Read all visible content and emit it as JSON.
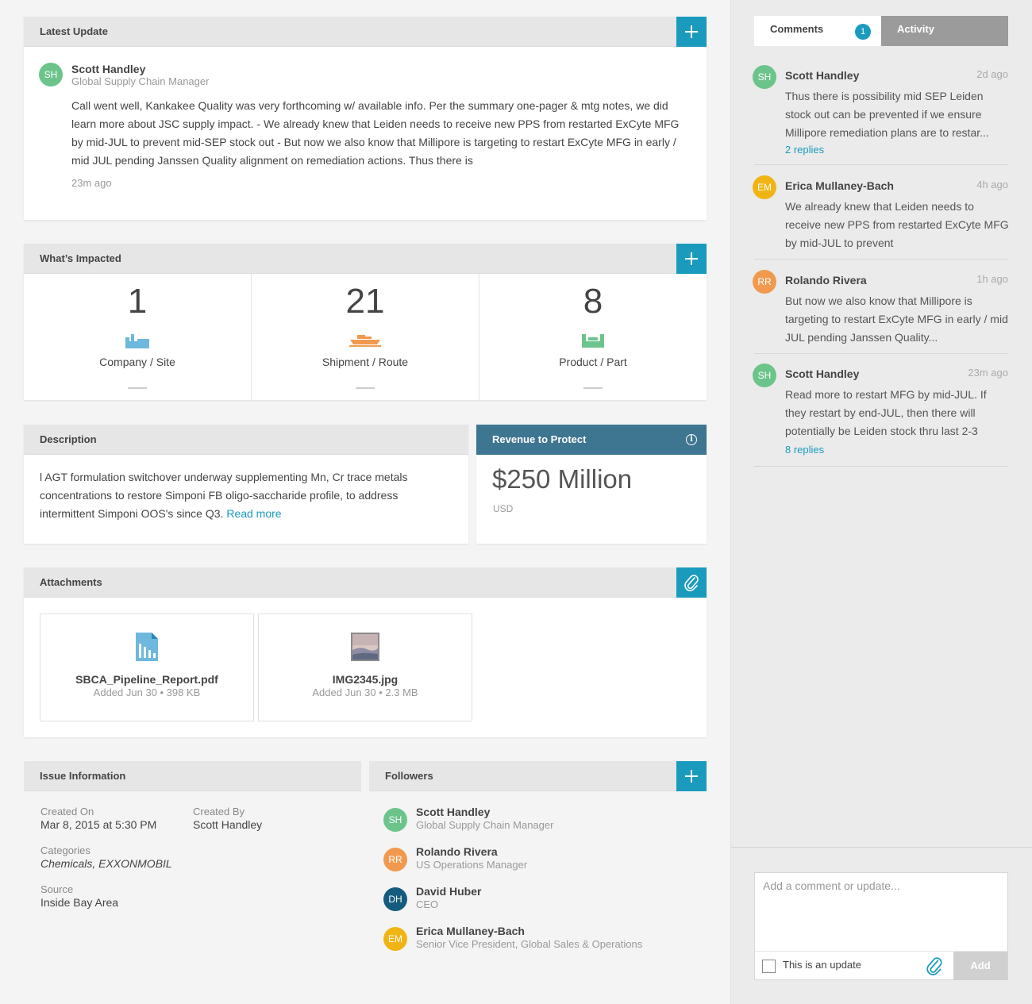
{
  "latest_update": {
    "title": "Latest Update",
    "author_initials": "SH",
    "author_name": "Scott Handley",
    "author_role": "Global Supply Chain Manager",
    "body": "Call went well, Kankakee Quality was very forthcoming w/ available info. Per the summary one-pager & mtg notes, we did learn more about JSC supply impact. - We already knew that Leiden needs to receive new PPS from restarted ExCyte MFG by mid-JUL to prevent mid-SEP stock out - But now we also know that Millipore is targeting to restart ExCyte MFG in early / mid JUL pending Janssen Quality alignment on remediation actions. Thus there is",
    "time": "23m ago"
  },
  "impacted": {
    "title": "What’s Impacted",
    "items": [
      {
        "count": "1",
        "label": "Company / Site",
        "icon": "factory-icon",
        "color": "#6fb8dd"
      },
      {
        "count": "21",
        "label": "Shipment / Route",
        "icon": "ship-icon",
        "color": "#f19a4f"
      },
      {
        "count": "8",
        "label": "Product / Part",
        "icon": "product-icon",
        "color": "#6cc48b"
      }
    ]
  },
  "description": {
    "title": "Description",
    "body": "l AGT formulation switchover underway supplementing Mn, Cr trace metals concentrations to restore Simponi FB oligo-saccharide profile, to address intermittent  Simponi OOS's since Q3. ",
    "read_more": "Read more"
  },
  "revenue": {
    "title": "Revenue to Protect",
    "amount": "$250 Million",
    "currency": "USD",
    "header_color": "#3e7591"
  },
  "attachments": {
    "title": "Attachments",
    "files": [
      {
        "name": "SBCA_Pipeline_Report.pdf",
        "meta": "Added Jun 30 • 398 KB",
        "icon": "pdf-file-icon"
      },
      {
        "name": "IMG2345.jpg",
        "meta": "Added Jun 30 • 2.3 MB",
        "icon": "image-thumbnail"
      }
    ]
  },
  "issue_info": {
    "title": "Issue Information",
    "created_on_label": "Created On",
    "created_on": "Mar 8, 2015 at 5:30 PM",
    "created_by_label": "Created By",
    "created_by": "Scott Handley",
    "categories_label": "Categories",
    "categories": "Chemicals, EXXONMOBIL",
    "source_label": "Source",
    "source": "Inside Bay Area"
  },
  "followers": {
    "title": "Followers",
    "people": [
      {
        "initials": "SH",
        "name": "Scott Handley",
        "role": "Global Supply Chain Manager",
        "color": "#6cc48b"
      },
      {
        "initials": "RR",
        "name": "Rolando Rivera",
        "role": "US Operations Manager",
        "color": "#f19a4f"
      },
      {
        "initials": "DH",
        "name": "David Huber",
        "role": "CEO",
        "color": "#155b7e"
      },
      {
        "initials": "EM",
        "name": "Erica Mullaney-Bach",
        "role": "Senior Vice President, Global Sales & Operations",
        "color": "#f1b415"
      }
    ]
  },
  "sidebar": {
    "tabs": {
      "comments": "Comments",
      "comments_badge": "1",
      "activity": "Activity"
    },
    "comments": [
      {
        "initials": "SH",
        "name": "Scott Handley",
        "time": "2d ago",
        "body": "Thus there is possibility mid SEP Leiden stock out can be prevented if we ensure Millipore remediation plans are to restar...",
        "replies": "2 replies",
        "color": "#6cc48b"
      },
      {
        "initials": "EM",
        "name": "Erica Mullaney-Bach",
        "time": "4h ago",
        "body": "We already knew that Leiden needs to receive new PPS from restarted ExCyte MFG by mid-JUL to prevent",
        "replies": "",
        "color": "#f1b415"
      },
      {
        "initials": "RR",
        "name": "Rolando Rivera",
        "time": "1h ago",
        "body": "But now we also know that Millipore is targeting to restart ExCyte MFG in early / mid JUL pending Janssen Quality...",
        "replies": "",
        "color": "#f19a4f"
      },
      {
        "initials": "SH",
        "name": "Scott Handley",
        "time": "23m ago",
        "body": "Read more to restart MFG by mid-JUL. If they restart by end-JUL, then there will potentially be Leiden stock  thru last 2-3",
        "replies": "8 replies",
        "color": "#6cc48b"
      }
    ],
    "composer": {
      "placeholder": "Add a comment or update...",
      "checkbox_label": "This is an update",
      "add_label": "Add"
    }
  }
}
